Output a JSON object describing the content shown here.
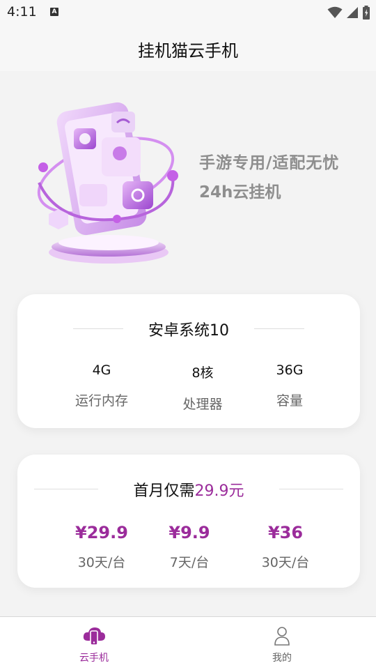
{
  "status_bar": {
    "time": "4:11",
    "notification_icon": "A",
    "icons": [
      "wifi-icon",
      "signal-icon",
      "battery-icon"
    ]
  },
  "app_bar": {
    "title": "挂机猫云手机"
  },
  "hero": {
    "line1": "手游专用/适配无忧",
    "line2": "24h云挂机"
  },
  "specs_card": {
    "title": "安卓系统10",
    "items": [
      {
        "value": "4G",
        "label": "运行内存"
      },
      {
        "value": "8核",
        "label": "处理器"
      },
      {
        "value": "36G",
        "label": "容量"
      }
    ]
  },
  "price_card": {
    "title_prefix": "首月仅需",
    "title_price": "29.9元",
    "items": [
      {
        "price": "¥29.9",
        "unit": "30天/台"
      },
      {
        "price": "¥9.9",
        "unit": "7天/台"
      },
      {
        "price": "¥36",
        "unit": "30天/台"
      }
    ]
  },
  "tab_bar": {
    "tabs": [
      {
        "label": "云手机",
        "icon": "cloud-phone-icon",
        "active": true
      },
      {
        "label": "我的",
        "icon": "user-icon",
        "active": false
      }
    ]
  },
  "colors": {
    "accent": "#9b2c9b",
    "background": "#f3f3f3",
    "hero_text": "#8e8e8e"
  }
}
